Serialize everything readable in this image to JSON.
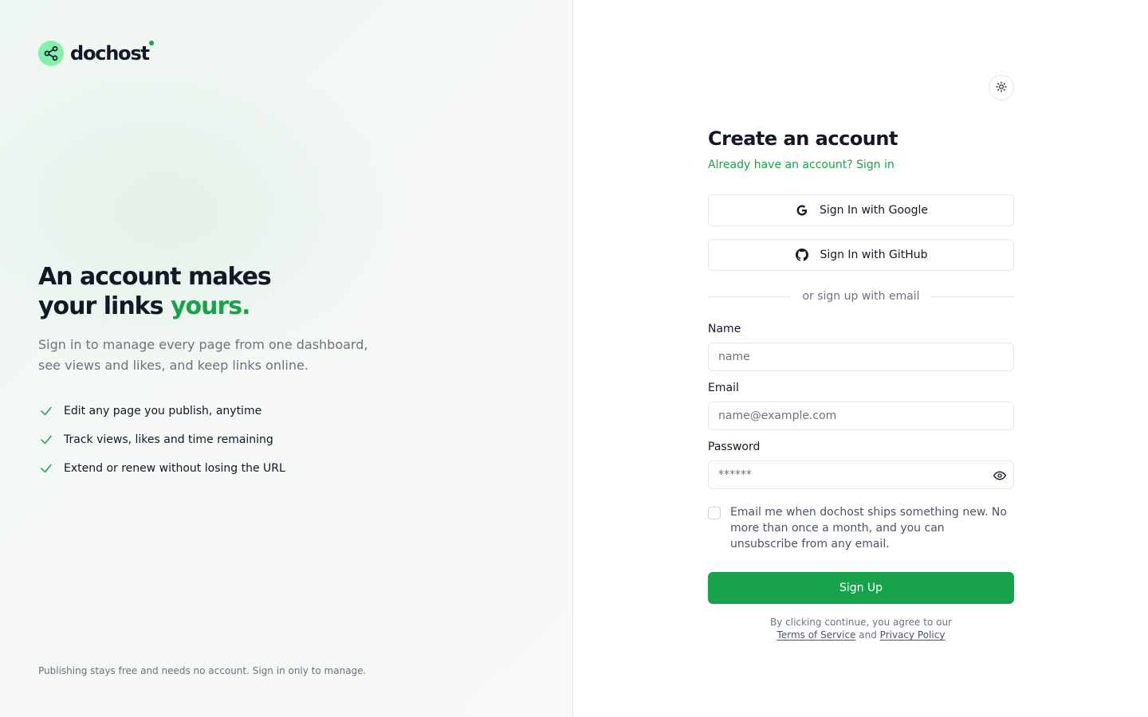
{
  "brand": {
    "name": "dochost",
    "logo_icon": "share-icon",
    "accent": "#16a34a",
    "logo_bg": "#86efac"
  },
  "hero": {
    "headline_line1": "An account makes",
    "headline_line2_prefix": "your links ",
    "headline_line2_accent": "yours.",
    "subtext": "Sign in to manage every page from one dashboard, see views and likes, and keep links online.",
    "features": [
      "Edit any page you publish, anytime",
      "Track views, likes and time remaining",
      "Extend or renew without losing the URL"
    ],
    "footnote": "Publishing stays free and needs no account. Sign in only to manage."
  },
  "theme_toggle": {
    "icon": "sun-icon"
  },
  "form": {
    "title": "Create an account",
    "signin_link": "Already have an account? Sign in",
    "google_button": "Sign In with Google",
    "github_button": "Sign In with GitHub",
    "divider": "or sign up with email",
    "name_label": "Name",
    "name_placeholder": "name",
    "email_label": "Email",
    "email_placeholder": "name@example.com",
    "password_label": "Password",
    "password_placeholder": "******",
    "consent_text": "Email me when dochost ships something new. No more than once a month, and you can unsubscribe from any email.",
    "submit_label": "Sign Up",
    "legal_prefix": "By clicking continue, you agree to our",
    "terms_link": "Terms of Service",
    "legal_and": "and",
    "privacy_link": "Privacy Policy"
  }
}
